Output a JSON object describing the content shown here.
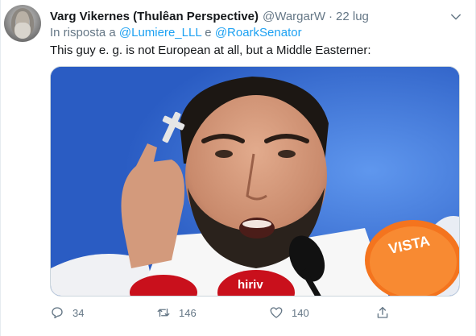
{
  "tweet": {
    "author": {
      "display_name": "Varg Vikernes (Thulêan Perspective)",
      "handle": "@WargarW",
      "separator": "·",
      "date": "22 lug"
    },
    "reply": {
      "prefix": "In risposta a",
      "mention_1": "@Lumiere_LLL",
      "conjunction": "e",
      "mention_2": "@RoarkSenator"
    },
    "text": "This guy e. g. is not European at all, but a Middle Easterner:",
    "media": {
      "mic_logo_1": "VISTA",
      "mic_logo_2": "hiriv"
    },
    "actions": {
      "reply_count": "34",
      "retweet_count": "146",
      "like_count": "140"
    },
    "icons": {
      "reply": "reply-icon",
      "retweet": "retweet-icon",
      "like": "heart-icon",
      "share": "share-icon",
      "more": "chevron-down-icon"
    },
    "colors": {
      "link": "#1da1f2",
      "secondary": "#657786",
      "text": "#14171a"
    }
  }
}
